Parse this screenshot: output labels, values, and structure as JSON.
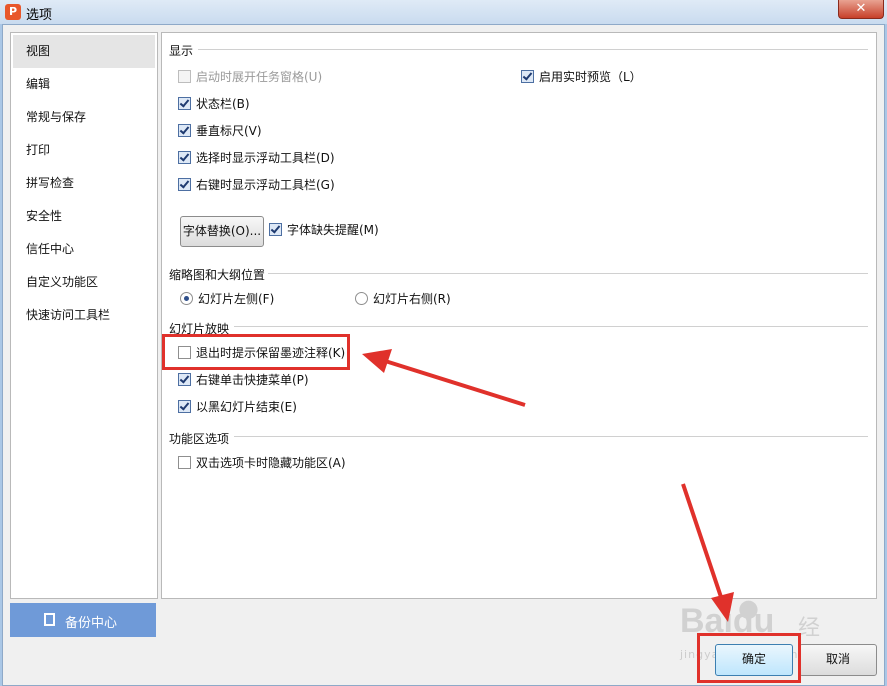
{
  "window": {
    "icon_letter": "P",
    "title": "选项",
    "close_glyph": "✕"
  },
  "sidebar": {
    "items": [
      {
        "label": "视图"
      },
      {
        "label": "编辑"
      },
      {
        "label": "常规与保存"
      },
      {
        "label": "打印"
      },
      {
        "label": "拼写检查"
      },
      {
        "label": "安全性"
      },
      {
        "label": "信任中心"
      },
      {
        "label": "自定义功能区"
      },
      {
        "label": "快速访问工具栏"
      }
    ],
    "selected_index": 0,
    "backup_label": "备份中心"
  },
  "sections": {
    "display": {
      "heading": "显示",
      "startup_task_pane": {
        "label": "启动时展开任务窗格(U)",
        "checked": false,
        "disabled": true
      },
      "realtime_preview": {
        "label": "启用实时预览（L）",
        "checked": true
      },
      "status_bar": {
        "label": "状态栏(B)",
        "checked": true
      },
      "vertical_ruler": {
        "label": "垂直标尺(V)",
        "checked": true
      },
      "float_toolbar_select": {
        "label": "选择时显示浮动工具栏(D)",
        "checked": true
      },
      "float_toolbar_right": {
        "label": "右键时显示浮动工具栏(G)",
        "checked": true
      },
      "font_replace_button": "字体替换(O)...",
      "missing_font_alert": {
        "label": "字体缺失提醒(M)",
        "checked": true
      }
    },
    "thumbnail": {
      "heading": "缩略图和大纲位置",
      "left": {
        "label": "幻灯片左侧(F)",
        "checked": true
      },
      "right": {
        "label": "幻灯片右侧(R)",
        "checked": false
      }
    },
    "slideshow": {
      "heading": "幻灯片放映",
      "prompt_keep_ink": {
        "label": "退出时提示保留墨迹注释(K)",
        "checked": false
      },
      "right_click_menu": {
        "label": "右键单击快捷菜单(P)",
        "checked": true
      },
      "end_with_black": {
        "label": "以黑幻灯片结束(E)",
        "checked": true
      }
    },
    "ribbon": {
      "heading": "功能区选项",
      "double_click_hide": {
        "label": "双击选项卡时隐藏功能区(A)",
        "checked": false
      }
    }
  },
  "footer": {
    "ok_label": "确定",
    "cancel_label": "取消"
  },
  "watermark": {
    "brand": "Baidu",
    "cn": "经验",
    "url": "jingyan.baidu.com"
  },
  "colors": {
    "annotation_red": "#e0312b",
    "backup_blue": "#6f9ad8"
  }
}
